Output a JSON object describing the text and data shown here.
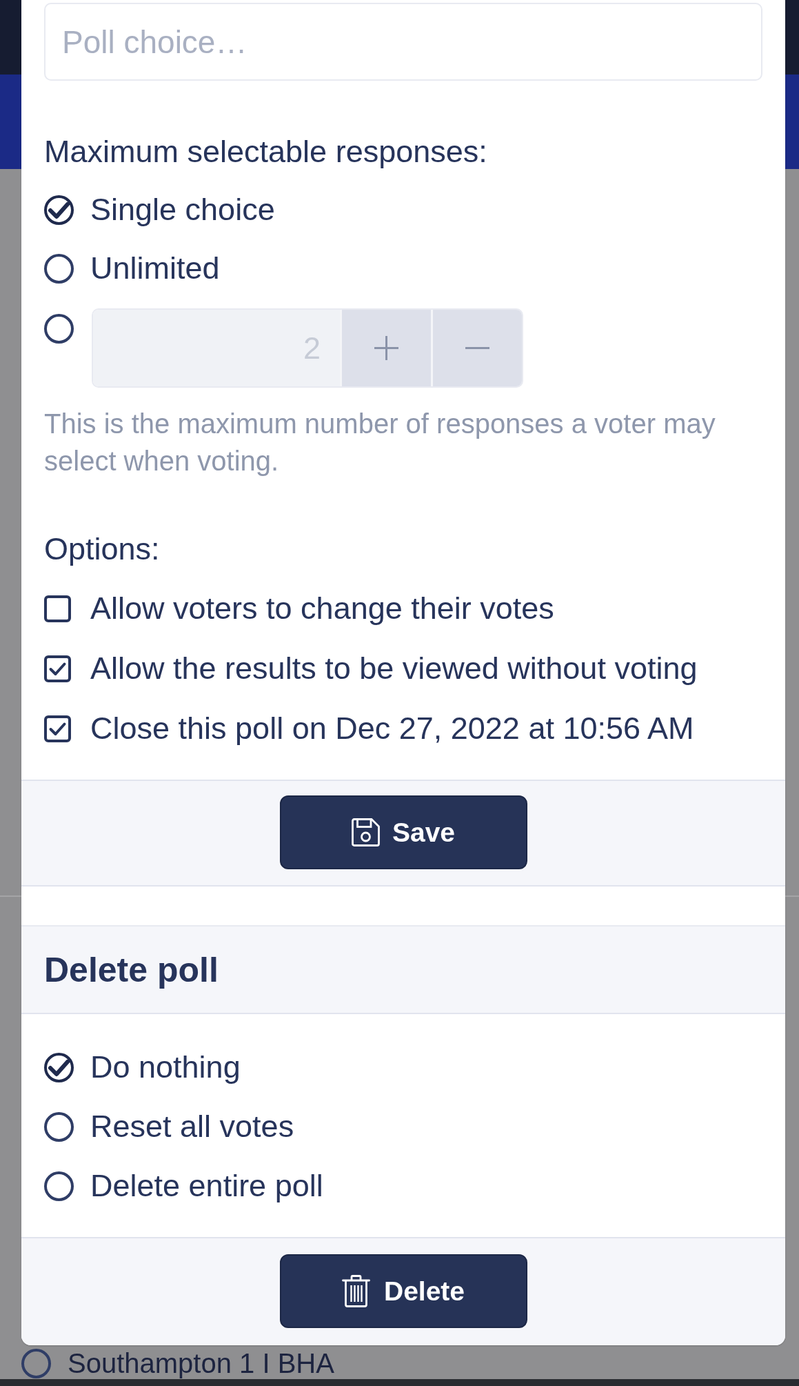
{
  "choice_field": {
    "placeholder": "Poll choice…"
  },
  "max_responses": {
    "label": "Maximum selectable responses:",
    "choices": [
      {
        "kind": "label",
        "label": "Single choice",
        "selected": true
      },
      {
        "kind": "label",
        "label": "Unlimited",
        "selected": false
      },
      {
        "kind": "stepper",
        "value": "2",
        "disabled": true,
        "selected": false
      }
    ],
    "help": "This is the maximum number of responses a voter may select when voting."
  },
  "options": {
    "label": "Options:",
    "items": [
      {
        "label": "Allow voters to change their votes",
        "checked": false
      },
      {
        "label": "Allow the results to be viewed without voting",
        "checked": true
      },
      {
        "label": "Close this poll on Dec 27, 2022 at 10:56 AM",
        "checked": true
      }
    ]
  },
  "save_button": {
    "label": "Save"
  },
  "delete_poll": {
    "title": "Delete poll",
    "choices": [
      {
        "label": "Do nothing",
        "selected": true
      },
      {
        "label": "Reset all votes",
        "selected": false
      },
      {
        "label": "Delete entire poll",
        "selected": false
      }
    ],
    "button": {
      "label": "Delete"
    }
  },
  "background": {
    "poll_choices": [
      {
        "label": "Southampton 1 I BHA",
        "selected": false
      }
    ]
  }
}
